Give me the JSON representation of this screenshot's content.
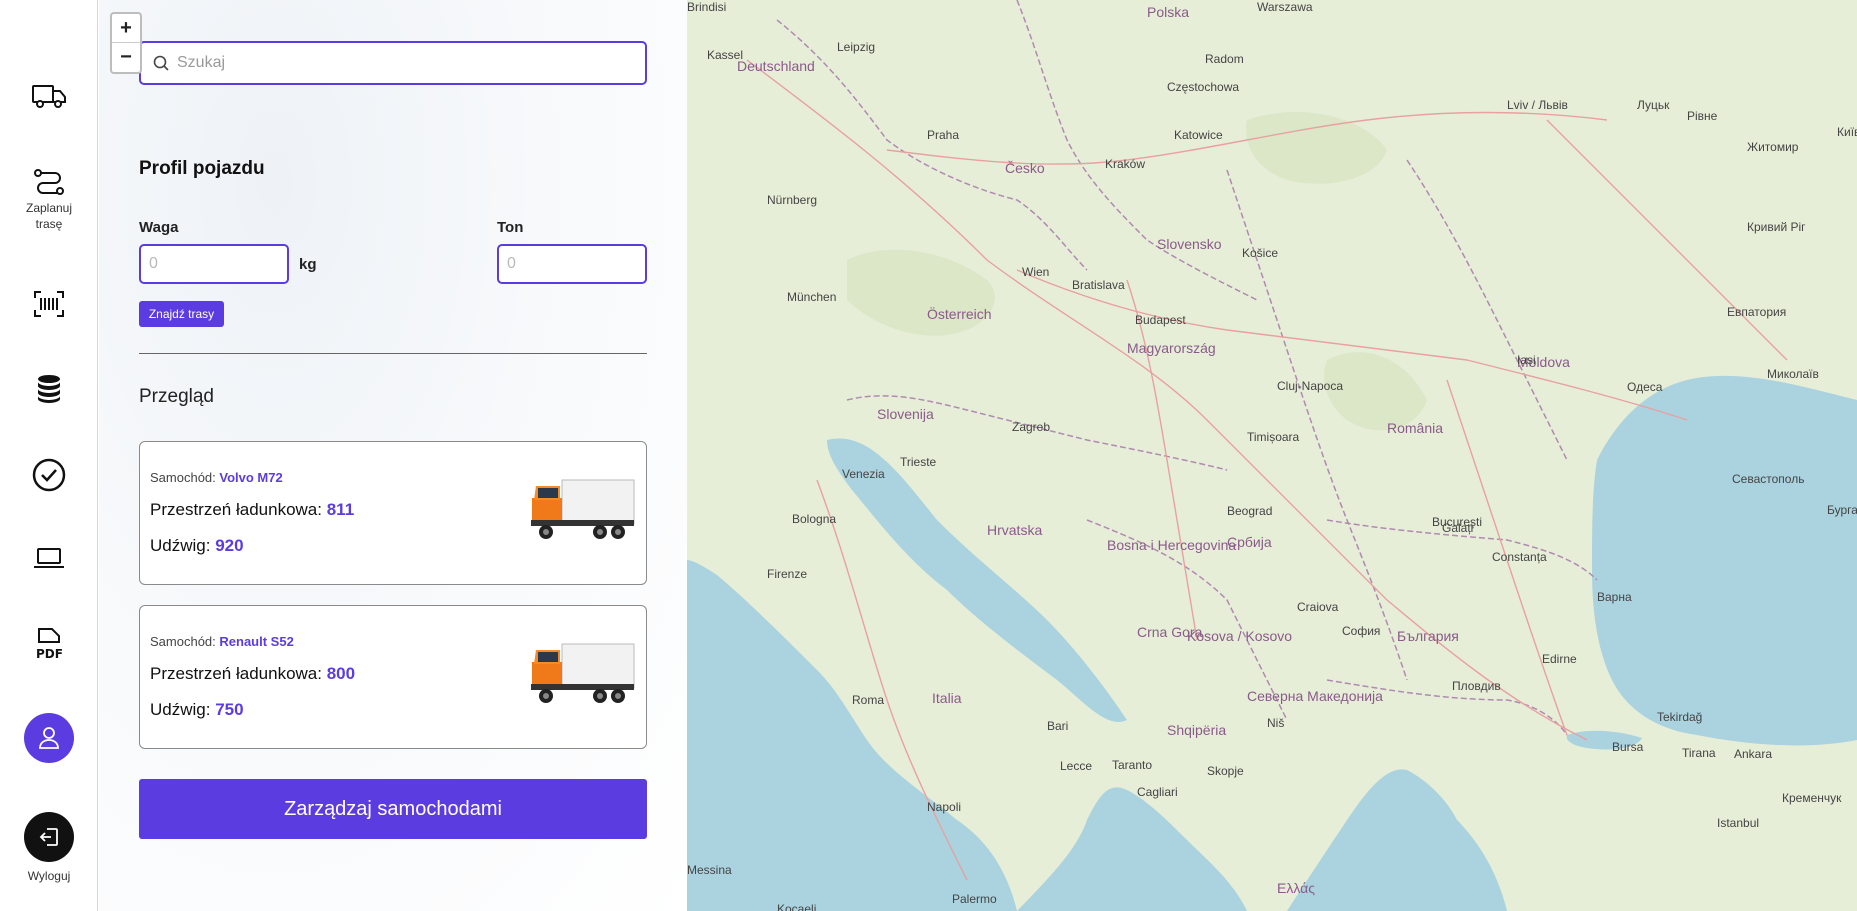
{
  "sidebar": {
    "items": [
      {
        "icon": "truck-icon"
      },
      {
        "icon": "route-icon",
        "label": "Zaplanuj trasę"
      },
      {
        "icon": "barcode-icon"
      },
      {
        "icon": "database-icon"
      },
      {
        "icon": "check-circle-icon"
      },
      {
        "icon": "laptop-icon"
      },
      {
        "icon": "pdf-icon"
      },
      {
        "icon": "user-icon"
      },
      {
        "icon": "logout-icon",
        "label": "Wyloguj"
      }
    ],
    "accent": "#5b3ce0"
  },
  "zoom": {
    "in": "+",
    "out": "−"
  },
  "search": {
    "placeholder": "Szukaj"
  },
  "profile": {
    "title": "Profil pojazdu",
    "weight_label": "Waga",
    "weight_placeholder": "0",
    "weight_unit": "kg",
    "ton_label": "Ton",
    "ton_placeholder": "0",
    "find_button": "Znajdź trasy"
  },
  "overview": {
    "title": "Przegląd",
    "cars": [
      {
        "car_label": "Samochód:",
        "model": "Volvo M72",
        "space_label": "Przestrzeń ładunkowa:",
        "space": "811",
        "capacity_label": "Udźwig:",
        "capacity": "920"
      },
      {
        "car_label": "Samochód:",
        "model": "Renault S52",
        "space_label": "Przestrzeń ładunkowa:",
        "space": "800",
        "capacity_label": "Udźwig:",
        "capacity": "750"
      }
    ],
    "manage_button": "Zarządzaj samochodami"
  },
  "map": {
    "labels": [
      {
        "text": "Deutschland",
        "kind": "country"
      },
      {
        "text": "Polska",
        "kind": "country"
      },
      {
        "text": "Česko",
        "kind": "country"
      },
      {
        "text": "Slovensko",
        "kind": "country"
      },
      {
        "text": "Österreich",
        "kind": "country"
      },
      {
        "text": "Magyarország",
        "kind": "country"
      },
      {
        "text": "România",
        "kind": "country"
      },
      {
        "text": "Moldova",
        "kind": "country"
      },
      {
        "text": "Slovenija",
        "kind": "country"
      },
      {
        "text": "Hrvatska",
        "kind": "country"
      },
      {
        "text": "Bosna i Hercegovina",
        "kind": "country"
      },
      {
        "text": "Србија",
        "kind": "country"
      },
      {
        "text": "България",
        "kind": "country"
      },
      {
        "text": "Italia",
        "kind": "country"
      },
      {
        "text": "Ελλάς",
        "kind": "country"
      },
      {
        "text": "Shqipëria",
        "kind": "country"
      },
      {
        "text": "Северна Македонија",
        "kind": "country"
      },
      {
        "text": "Crna Gora",
        "kind": "country"
      },
      {
        "text": "Kosova / Kosovo",
        "kind": "country"
      },
      {
        "text": "Warszawa",
        "kind": "city"
      },
      {
        "text": "Leipzig",
        "kind": "city"
      },
      {
        "text": "Kassel",
        "kind": "city"
      },
      {
        "text": "Praha",
        "kind": "city"
      },
      {
        "text": "Nürnberg",
        "kind": "city"
      },
      {
        "text": "München",
        "kind": "city"
      },
      {
        "text": "Wien",
        "kind": "city"
      },
      {
        "text": "Bratislava",
        "kind": "city"
      },
      {
        "text": "Budapest",
        "kind": "city"
      },
      {
        "text": "Katowice",
        "kind": "city"
      },
      {
        "text": "Częstochowa",
        "kind": "city"
      },
      {
        "text": "Radom",
        "kind": "city"
      },
      {
        "text": "Kraków",
        "kind": "city"
      },
      {
        "text": "Košice",
        "kind": "city"
      },
      {
        "text": "Zagreb",
        "kind": "city"
      },
      {
        "text": "Beograd",
        "kind": "city"
      },
      {
        "text": "Cluj-Napoca",
        "kind": "city"
      },
      {
        "text": "Timișoara",
        "kind": "city"
      },
      {
        "text": "București",
        "kind": "city"
      },
      {
        "text": "Constanța",
        "kind": "city"
      },
      {
        "text": "Варна",
        "kind": "city"
      },
      {
        "text": "София",
        "kind": "city"
      },
      {
        "text": "Пловдив",
        "kind": "city"
      },
      {
        "text": "Bologna",
        "kind": "city"
      },
      {
        "text": "Firenze",
        "kind": "city"
      },
      {
        "text": "Roma",
        "kind": "city"
      },
      {
        "text": "Venezia",
        "kind": "city"
      },
      {
        "text": "Trieste",
        "kind": "city"
      },
      {
        "text": "Bari",
        "kind": "city"
      },
      {
        "text": "Napoli",
        "kind": "city"
      },
      {
        "text": "Lviv / Львів",
        "kind": "city"
      },
      {
        "text": "Луцьк",
        "kind": "city"
      },
      {
        "text": "Рівне",
        "kind": "city"
      },
      {
        "text": "Житомир",
        "kind": "city"
      },
      {
        "text": "Київ",
        "kind": "city"
      },
      {
        "text": "Миколаїв",
        "kind": "city"
      },
      {
        "text": "Одеса",
        "kind": "city"
      },
      {
        "text": "Iași",
        "kind": "city"
      },
      {
        "text": "Galați",
        "kind": "city"
      },
      {
        "text": "Craiova",
        "kind": "city"
      },
      {
        "text": "Niš",
        "kind": "city"
      },
      {
        "text": "Skopje",
        "kind": "city"
      },
      {
        "text": "Tirana",
        "kind": "city"
      },
      {
        "text": "Istanbul",
        "kind": "city"
      },
      {
        "text": "Bursa",
        "kind": "city"
      },
      {
        "text": "Tekirdağ",
        "kind": "city"
      },
      {
        "text": "Edirne",
        "kind": "city"
      },
      {
        "text": "Бургас",
        "kind": "city"
      },
      {
        "text": "Севастополь",
        "kind": "city"
      },
      {
        "text": "Евпатория",
        "kind": "city"
      },
      {
        "text": "Кривий Ріг",
        "kind": "city"
      },
      {
        "text": "Крeменчук",
        "kind": "city"
      },
      {
        "text": "Ankara",
        "kind": "city"
      },
      {
        "text": "Kocaeli",
        "kind": "city"
      },
      {
        "text": "Palermo",
        "kind": "city"
      },
      {
        "text": "Messina",
        "kind": "city"
      },
      {
        "text": "Cagliari",
        "kind": "city"
      },
      {
        "text": "Lecce",
        "kind": "city"
      },
      {
        "text": "Taranto",
        "kind": "city"
      },
      {
        "text": "Brindisi",
        "kind": "city"
      }
    ]
  }
}
